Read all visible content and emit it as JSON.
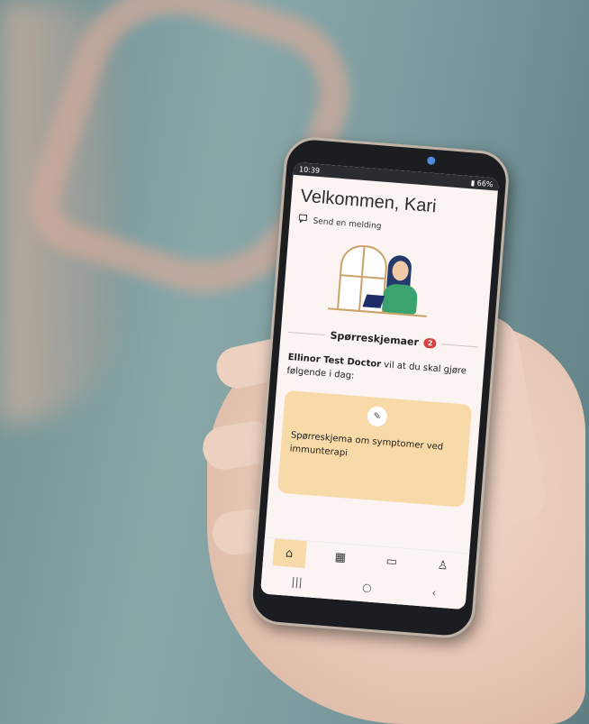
{
  "status_bar": {
    "time": "10:39",
    "battery": "66%"
  },
  "home": {
    "title": "Velkommen, Kari",
    "send_message_label": "Send en melding",
    "section_title": "Spørreskjemaer",
    "section_badge": "2",
    "doctor_name": "Ellinor Test Doctor",
    "info_text": "vil at du skal gjøre følgende i dag:",
    "card_text": "Spørreskjema om symptomer ved immunterapi"
  },
  "tabs": [
    {
      "icon": "home-icon",
      "active": true
    },
    {
      "icon": "calendar-icon",
      "active": false
    },
    {
      "icon": "messages-icon",
      "active": false
    },
    {
      "icon": "profile-icon",
      "active": false
    }
  ],
  "colors": {
    "accent": "#f8d9a8",
    "badge": "#d84040",
    "screen_bg": "#fbf4f3"
  }
}
